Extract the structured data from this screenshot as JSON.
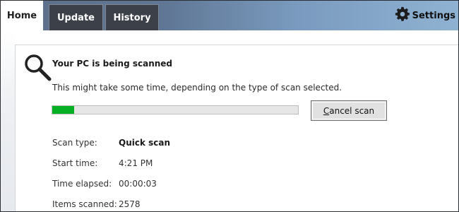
{
  "tabs": [
    {
      "label": "Home"
    },
    {
      "label": "Update"
    },
    {
      "label": "History"
    }
  ],
  "settings": {
    "label": "Settings",
    "icon": "gear-icon"
  },
  "scan": {
    "title": "Your PC is being scanned",
    "description": "This might take some time, depending on the type of scan selected.",
    "progress_fraction": 0.09,
    "cancel_button": {
      "mnemonic": "C",
      "rest": "ancel scan"
    },
    "icon": "magnifier-icon"
  },
  "details": [
    {
      "label": "Scan type:",
      "value": "Quick scan"
    },
    {
      "label": "Start time:",
      "value": "4:21 PM"
    },
    {
      "label": "Time elapsed:",
      "value": "00:00:03"
    },
    {
      "label": "Items scanned:",
      "value": "2578"
    }
  ],
  "colors": {
    "progress_fill": "#06b025",
    "active_tab": "#ffffff",
    "inactive_tab": "#3b4049"
  }
}
